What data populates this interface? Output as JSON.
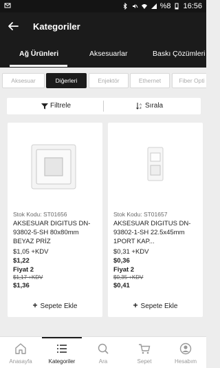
{
  "status_bar": {
    "signal_label": "%8",
    "time": "16:56"
  },
  "app_bar": {
    "title": "Kategoriler"
  },
  "tabs": [
    {
      "label": "Ağ Ürünleri",
      "active": true
    },
    {
      "label": "Aksesuarlar",
      "active": false
    },
    {
      "label": "Baskı Çözümleri",
      "active": false
    }
  ],
  "chips": [
    {
      "label": "Aksesuar",
      "active": false
    },
    {
      "label": "Diğerleri",
      "active": true
    },
    {
      "label": "Enjektör",
      "active": false
    },
    {
      "label": "Ethernet",
      "active": false
    },
    {
      "label": "Fiber Opti",
      "active": false
    }
  ],
  "filter_bar": {
    "filter_label": "Filtrele",
    "sort_label": "Sırala"
  },
  "products": [
    {
      "code": "Stok Kodu: ST01656",
      "name": "AKSESUAR DIGITUS DN-93802-5-SH 80x80mm BEYAZ PRİZ",
      "price_kdv": "$1,05 +KDV",
      "price": "$1,22",
      "fiyat_label": "Fiyat 2",
      "old_price": "$1,17 +KDV",
      "new_price": "$1,36",
      "add_label": "Sepete Ekle"
    },
    {
      "code": "Stok Kodu: ST01657",
      "name": "AKSESUAR DIGITUS DN-93802-1-SH 22.5x45mm 1PORT KAP...",
      "price_kdv": "$0,31 +KDV",
      "price": "$0,36",
      "fiyat_label": "Fiyat 2",
      "old_price": "$0,35 +KDV",
      "new_price": "$0,41",
      "add_label": "Sepete Ekle"
    }
  ],
  "bottom_nav": [
    {
      "label": "Anasayfa",
      "icon": "home-icon",
      "active": false
    },
    {
      "label": "Kategoriler",
      "icon": "list-icon",
      "active": true
    },
    {
      "label": "Ara",
      "icon": "search-icon",
      "active": false
    },
    {
      "label": "Sepet",
      "icon": "cart-icon",
      "active": false
    },
    {
      "label": "Hesabım",
      "icon": "account-icon",
      "active": false
    }
  ],
  "colors": {
    "bar_dark": "#1b1b1b",
    "background": "#ededed",
    "card": "#ffffff"
  }
}
